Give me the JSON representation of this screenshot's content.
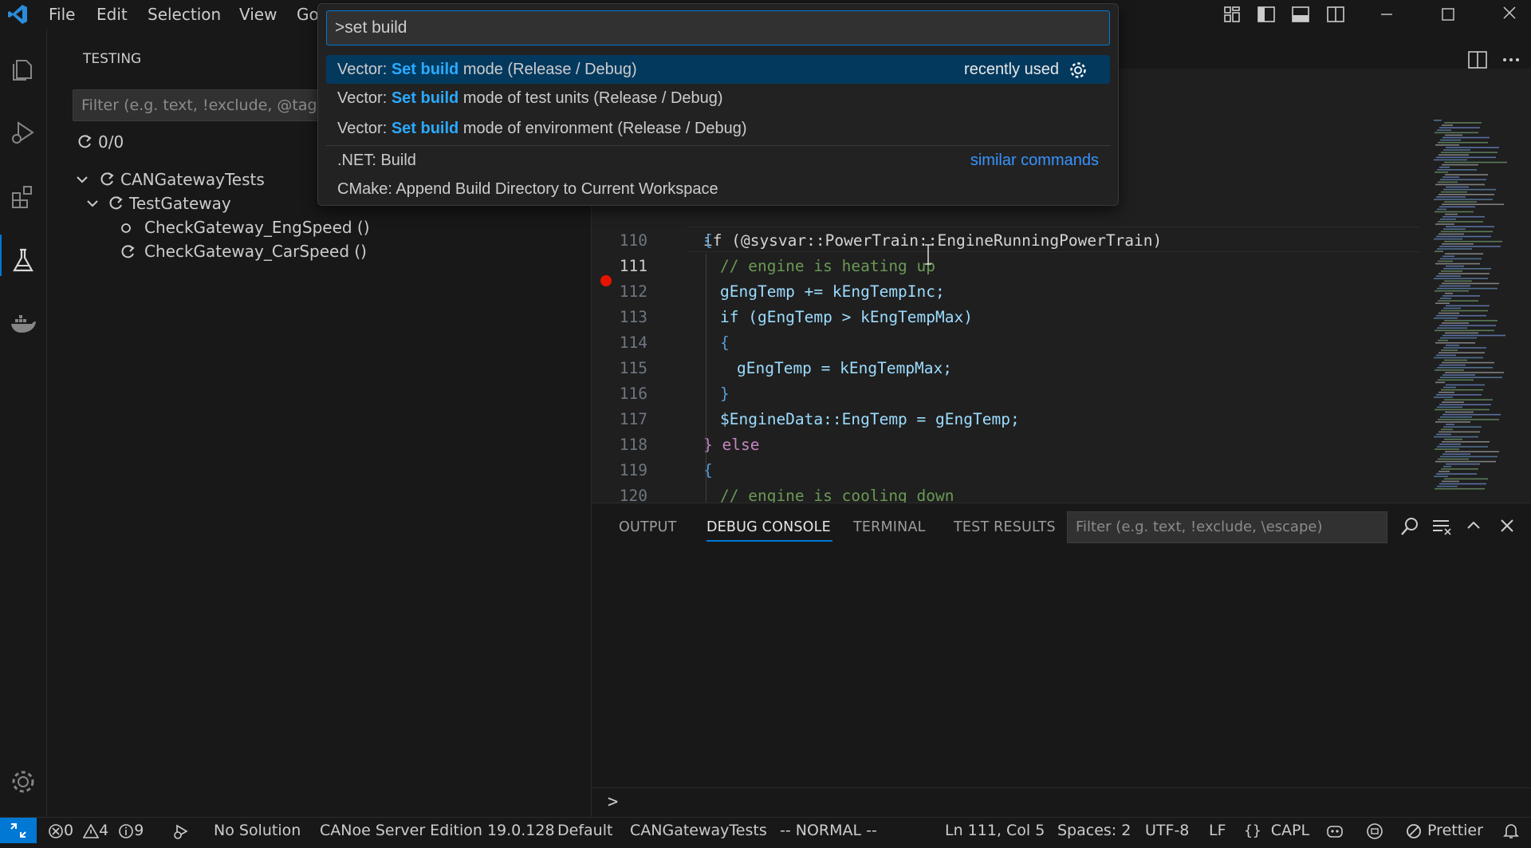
{
  "titlebar": {
    "menus": [
      "File",
      "Edit",
      "Selection",
      "View",
      "Go"
    ]
  },
  "command_palette": {
    "input_value": ">set build",
    "items": [
      {
        "prefix": "Vector: ",
        "match": "Set build",
        "rest": " mode (Release / Debug)",
        "hint": "recently used"
      },
      {
        "prefix": "Vector: ",
        "match": "Set build",
        "rest": " mode of test units (Release / Debug)"
      },
      {
        "prefix": "Vector: ",
        "match": "Set build",
        "rest": " mode of environment (Release / Debug)"
      }
    ],
    "similar": [
      {
        "label": ".NET: Build",
        "hint": "similar commands"
      },
      {
        "label": "CMake: Append Build Directory to Current Workspace"
      }
    ]
  },
  "sidebar": {
    "title": "TESTING",
    "filter_placeholder": "Filter (e.g. text, !exclude, @tag)",
    "counter": "0/0",
    "tree": {
      "root": "CANGatewayTests",
      "group": "TestGateway",
      "tests": [
        "CheckGateway_EngSpeed ()",
        "CheckGateway_CarSpeed ()"
      ]
    }
  },
  "editor": {
    "partial_line": "if (@sysvar::PowerTrain::EngineRunningPowerTrain)",
    "lines": [
      {
        "num": "110",
        "code": "{"
      },
      {
        "num": "111",
        "code": "// engine is heating up"
      },
      {
        "num": "112",
        "code": "gEngTemp += kEngTempInc;"
      },
      {
        "num": "113",
        "code": "if (gEngTemp > kEngTempMax)"
      },
      {
        "num": "114",
        "code": "{"
      },
      {
        "num": "115",
        "code": "gEngTemp = kEngTempMax;"
      },
      {
        "num": "116",
        "code": "}"
      },
      {
        "num": "117",
        "code": "$EngineData::EngTemp = gEngTemp;"
      },
      {
        "num": "118",
        "code": "} else"
      },
      {
        "num": "119",
        "code": "{"
      },
      {
        "num": "120",
        "code": "// engine is cooling down"
      }
    ],
    "current_line": "111",
    "breakpoint_line": "112"
  },
  "panel": {
    "tabs": [
      "OUTPUT",
      "DEBUG CONSOLE",
      "TERMINAL",
      "TEST RESULTS"
    ],
    "active_tab": "DEBUG CONSOLE",
    "filter_placeholder": "Filter (e.g. text, !exclude, \\escape)",
    "prompt": ">"
  },
  "statusbar": {
    "errors": "0",
    "warnings": "4",
    "infos": "9",
    "solution": "No Solution",
    "server": "CANoe Server Edition 19.0.128",
    "config": "Default",
    "project": "CANGatewayTests",
    "mode": "-- NORMAL --",
    "position": "Ln 111, Col 5",
    "spaces": "Spaces: 2",
    "encoding": "UTF-8",
    "eol": "LF",
    "language": "CAPL",
    "formatter": "Prettier"
  },
  "colors": {
    "accent": "#0078d4",
    "highlight": "#2aaaff",
    "keyword": "#569cd6",
    "comment": "#6a9955",
    "variable": "#9cdcfe",
    "breakpoint": "#e51400"
  }
}
